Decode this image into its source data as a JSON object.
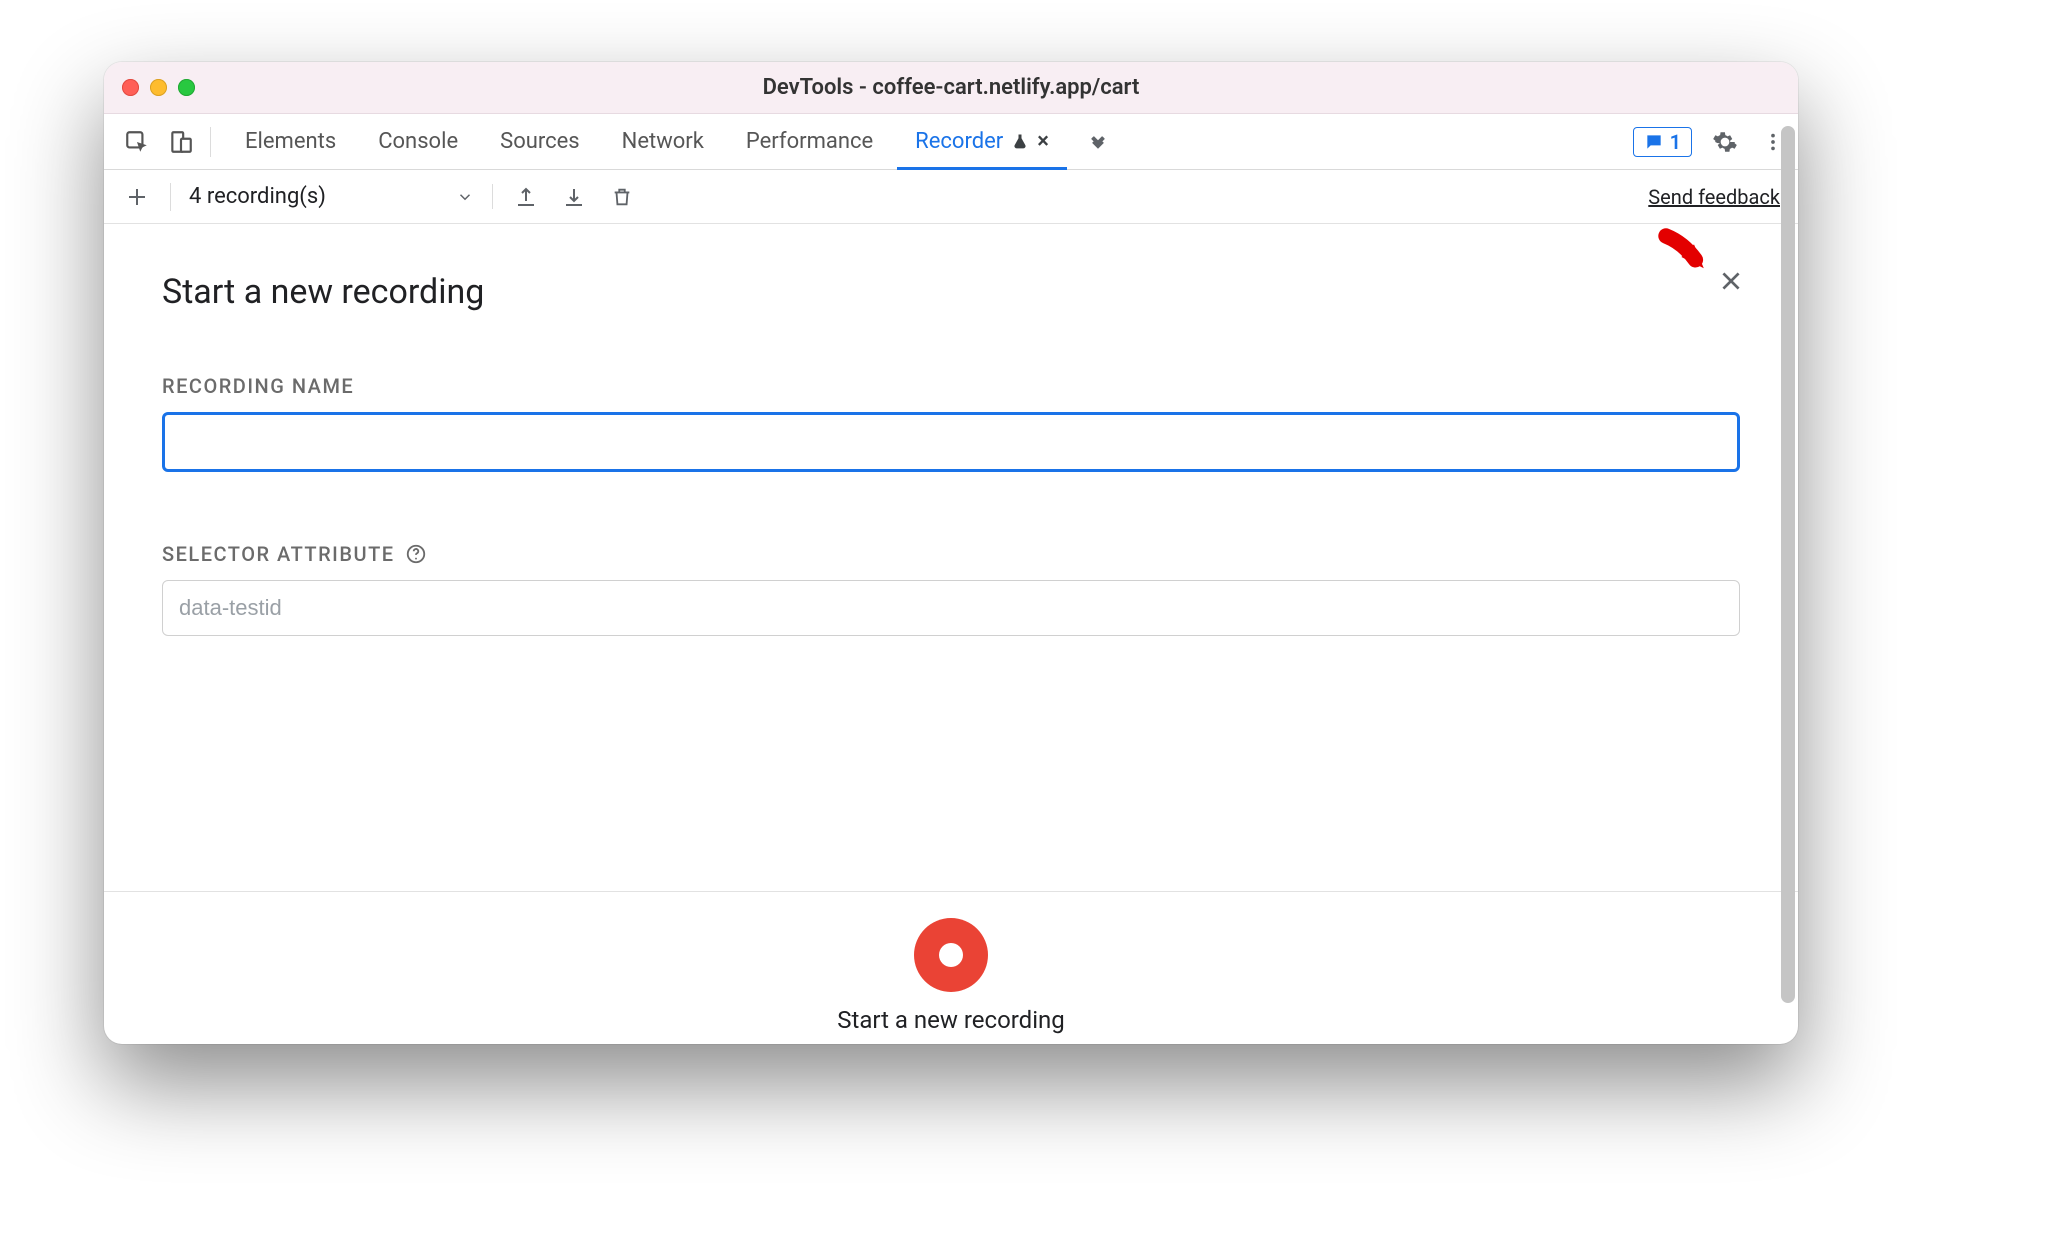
{
  "window": {
    "title": "DevTools - coffee-cart.netlify.app/cart"
  },
  "tabs": {
    "items": [
      "Elements",
      "Console",
      "Sources",
      "Network",
      "Performance"
    ],
    "active": {
      "label": "Recorder"
    },
    "messages_count": "1"
  },
  "toolbar": {
    "dropdown_label": "4 recording(s)",
    "send_feedback_label": "Send feedback"
  },
  "panel": {
    "heading": "Start a new recording",
    "recording_name_label": "RECORDING NAME",
    "recording_name_value": "",
    "selector_attr_label": "SELECTOR ATTRIBUTE",
    "selector_attr_placeholder": "data-testid",
    "selector_attr_value": ""
  },
  "footer": {
    "start_label": "Start a new recording"
  }
}
